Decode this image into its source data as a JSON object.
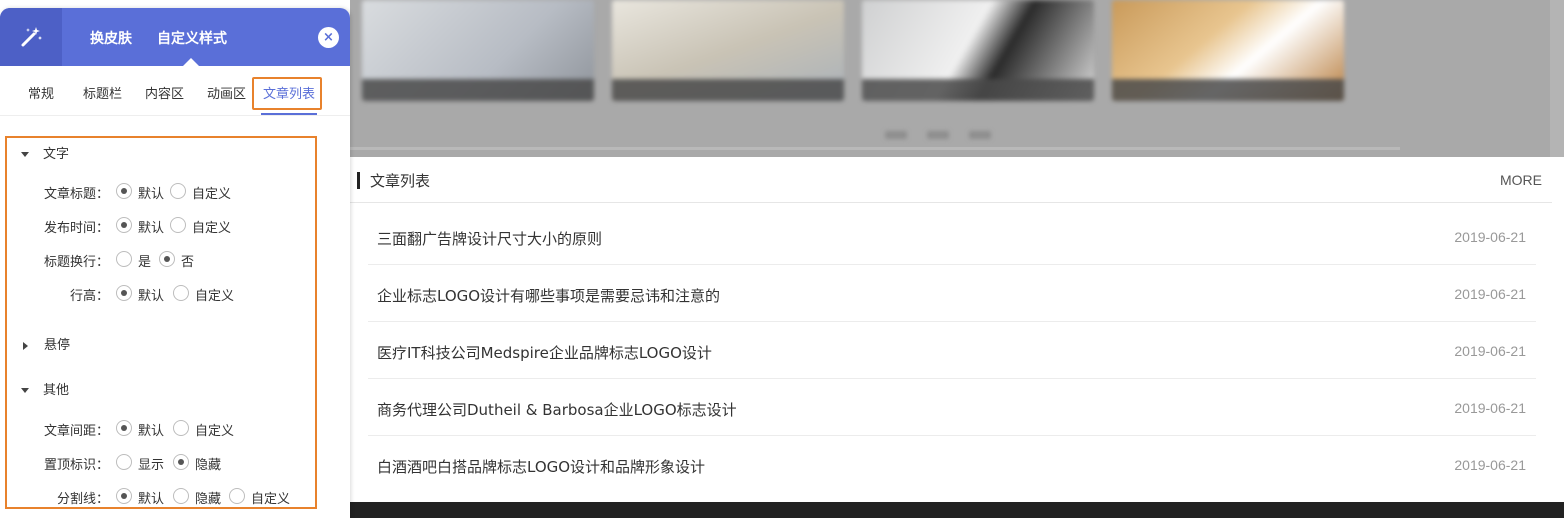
{
  "panel": {
    "header_tabs": [
      "换皮肤",
      "自定义样式"
    ],
    "close_symbol": "×",
    "accent_color": "#5a6fd8",
    "highlight_color": "#e8822c",
    "subtabs": [
      "常规",
      "标题栏",
      "内容区",
      "动画区",
      "文章列表"
    ],
    "active_subtab": "文章列表",
    "groups": {
      "text": {
        "title": "文字",
        "expanded": true,
        "rows": [
          {
            "label": "文章标题：",
            "options": [
              "默认",
              "自定义"
            ],
            "selected": "默认"
          },
          {
            "label": "发布时间：",
            "options": [
              "默认",
              "自定义"
            ],
            "selected": "默认"
          },
          {
            "label": "标题换行：",
            "options": [
              "是",
              "否"
            ],
            "selected": "否"
          },
          {
            "label": "行高：",
            "options": [
              "默认",
              "自定义"
            ],
            "selected": "默认"
          }
        ]
      },
      "hover": {
        "title": "悬停",
        "expanded": false
      },
      "other": {
        "title": "其他",
        "expanded": true,
        "rows": [
          {
            "label": "文章间距：",
            "options": [
              "默认",
              "自定义"
            ],
            "selected": "默认"
          },
          {
            "label": "置顶标识：",
            "options": [
              "显示",
              "隐藏"
            ],
            "selected": "隐藏"
          },
          {
            "label": "分割线：",
            "options": [
              "默认",
              "隐藏",
              "自定义"
            ],
            "selected": "默认"
          }
        ]
      }
    }
  },
  "module": {
    "title": "文章列表",
    "more": "MORE",
    "articles": [
      {
        "title": "三面翻广告牌设计尺寸大小的原则",
        "date": "2019-06-21"
      },
      {
        "title": "企业标志LOGO设计有哪些事项是需要忌讳和注意的",
        "date": "2019-06-21"
      },
      {
        "title": "医疗IT科技公司Medspire企业品牌标志LOGO设计",
        "date": "2019-06-21"
      },
      {
        "title": "商务代理公司Dutheil & Barbosa企业LOGO标志设计",
        "date": "2019-06-21"
      },
      {
        "title": "白酒酒吧白搭品牌标志LOGO设计和品牌形象设计",
        "date": "2019-06-21"
      }
    ]
  }
}
